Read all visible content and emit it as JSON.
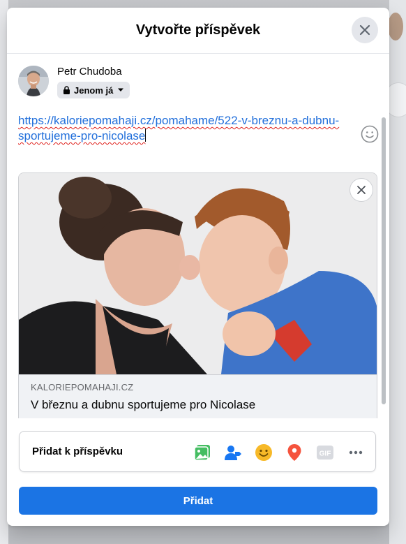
{
  "modal": {
    "title": "Vytvořte příspěvek"
  },
  "author": {
    "name": "Petr Chudoba",
    "privacy_label": "Jenom já"
  },
  "composer": {
    "text_line1": "https://kaloriepomahaji.cz/pomahame/522-v-breznu-a-dubnu-",
    "text_line2": "sportujeme-pro-nicolase"
  },
  "link_preview": {
    "domain": "KALORIEPOMAHAJI.CZ",
    "headline": "V březnu a dubnu sportujeme pro Nicolase"
  },
  "add_to_post": {
    "label": "Přidat k příspěvku",
    "tools": [
      "photo-video-icon",
      "tag-people-icon",
      "feeling-icon",
      "check-in-icon",
      "gif-icon",
      "more-icon"
    ],
    "gif_label": "GIF"
  },
  "submit": {
    "label": "Přidat"
  },
  "colors": {
    "primary": "#1b74e4",
    "link_text": "#216fdb",
    "photo_green": "#45bd62",
    "tag_blue": "#1877f2",
    "feeling_yellow": "#f7b928",
    "checkin_red": "#f5533d"
  }
}
